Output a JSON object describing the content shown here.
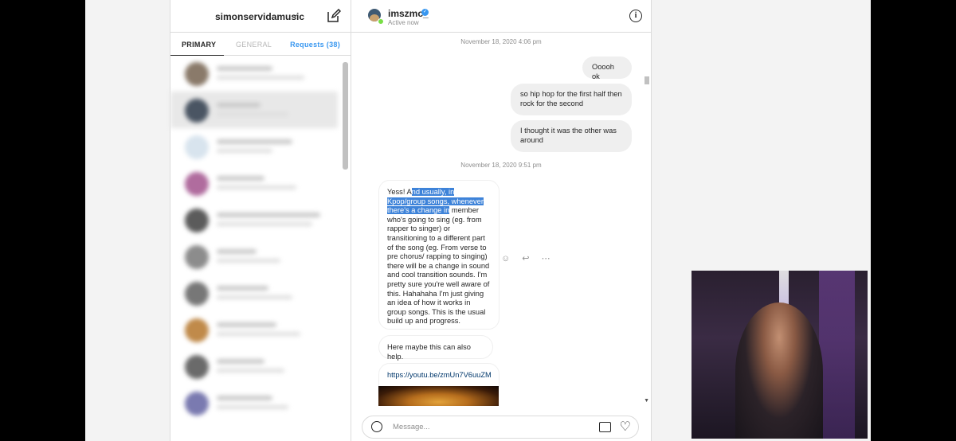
{
  "inbox": {
    "account_name": "simonservidamusic",
    "tabs": {
      "primary": "PRIMARY",
      "general": "GENERAL",
      "requests": "Requests (38)"
    }
  },
  "chat": {
    "username": "imszmc_",
    "status": "Active now",
    "messages": [
      {
        "type": "timestamp",
        "text": "November 18, 2020 4:06 pm"
      },
      {
        "from": "me",
        "text": "Ooooh ok"
      },
      {
        "from": "me",
        "text": "so hip hop for the first half then rock for the second"
      },
      {
        "from": "me",
        "text": "I thought it was the other was around"
      },
      {
        "type": "timestamp",
        "text": "November 18, 2020 9:51 pm"
      },
      {
        "from": "them",
        "text_before": "Yess! A",
        "text_highlighted": "nd usually, in Kpop/group songs, whenever there's a change in",
        "text_after": " member who's going to sing (eg. from rapper to singer) or transitioning to a different part of the song (eg. From verse to pre chorus/ rapping to singing) there will be a change in sound and cool transition sounds. I'm pretty sure you're well aware of this. Hahahaha I'm just giving an idea of how it works in group songs. This is the usual build up and progress."
      },
      {
        "from": "them",
        "text": "Here maybe this can also help."
      },
      {
        "from": "them",
        "text": "https://youtu.be/zmUn7V6uuZM"
      }
    ],
    "composer_placeholder": "Message..."
  }
}
